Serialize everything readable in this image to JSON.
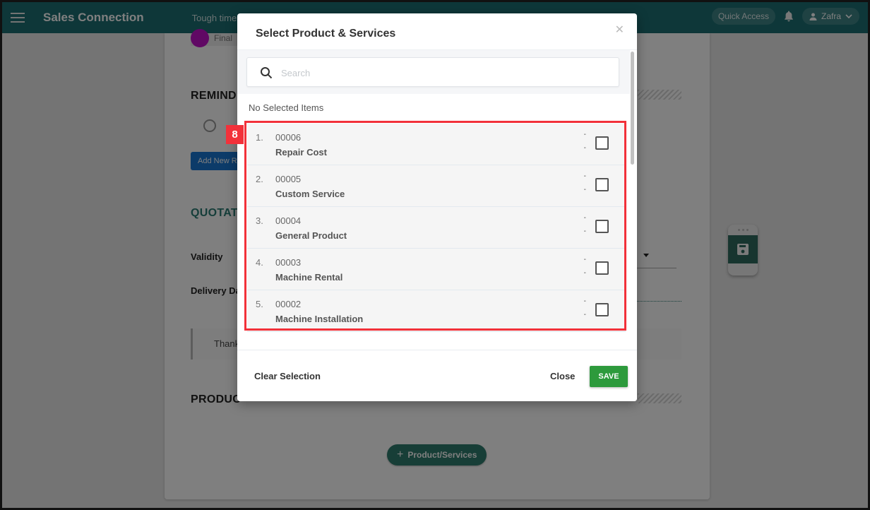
{
  "topnav": {
    "brand": "Sales Connection",
    "tagline": "Tough times",
    "quick_access_label": "Quick Access",
    "user_name": "Zafra"
  },
  "background_page": {
    "stage_label": "Final",
    "reminder_section_title": "REMIND",
    "add_reminder_label": "Add New R",
    "quotation_section_title": "QUOTAT",
    "validity_label": "Validity",
    "delivery_date_label": "Delivery Da",
    "notes_text": "Thank",
    "products_section_title": "PRODUC",
    "add_product_label": "Product/Services"
  },
  "modal": {
    "title": "Select Product & Services",
    "search_placeholder": "Search",
    "search_value": "",
    "selected_status": "No Selected Items",
    "items": [
      {
        "index": "1.",
        "code": "00006",
        "name": "Repair Cost",
        "line1": "-",
        "line2": "-",
        "checked": false
      },
      {
        "index": "2.",
        "code": "00005",
        "name": "Custom Service",
        "line1": "-",
        "line2": "-",
        "checked": false
      },
      {
        "index": "3.",
        "code": "00004",
        "name": "General Product",
        "line1": "-",
        "line2": "-",
        "checked": false
      },
      {
        "index": "4.",
        "code": "00003",
        "name": "Machine Rental",
        "line1": "-",
        "line2": "-",
        "checked": false
      },
      {
        "index": "5.",
        "code": "00002",
        "name": "Machine Installation",
        "line1": "-",
        "line2": "-",
        "checked": false
      }
    ],
    "footer": {
      "clear_selection_label": "Clear Selection",
      "close_label": "Close",
      "save_label": "SAVE"
    }
  },
  "annotation": {
    "badge_number": "8",
    "color": "#f2313a"
  },
  "colors": {
    "nav_teal": "#1d6f73",
    "save_green": "#2d9a3c",
    "section_teal": "#2b7c74",
    "button_blue": "#1976d2"
  }
}
